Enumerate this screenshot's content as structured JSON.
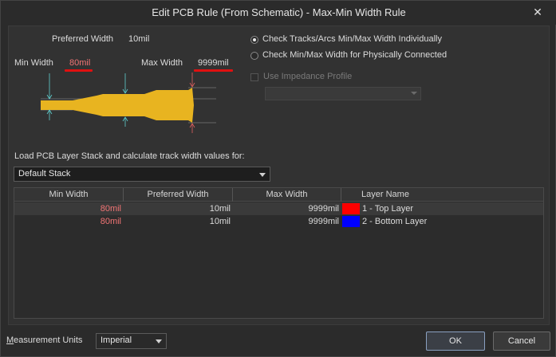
{
  "window": {
    "title": "Edit PCB Rule (From Schematic) - Max-Min Width Rule",
    "close_glyph": "✕"
  },
  "diagram": {
    "preferred_label": "Preferred Width",
    "preferred_value": "10mil",
    "min_label": "Min Width",
    "min_value": "80mil",
    "max_label": "Max Width",
    "max_value": "9999mil",
    "track_color": "#e8b420"
  },
  "options": {
    "radio_individual": "Check Tracks/Arcs Min/Max Width Individually",
    "radio_connected": "Check Min/Max Width for Physically Connected",
    "selected": "individual",
    "impedance_label": "Use Impedance Profile",
    "impedance_checked": false
  },
  "stack": {
    "label": "Load PCB Layer Stack and calculate track width values for:",
    "selected": "Default Stack"
  },
  "table": {
    "headers": [
      "Min Width",
      "Preferred Width",
      "Max Width",
      "Layer Name"
    ],
    "rows": [
      {
        "min": "80mil",
        "preferred": "10mil",
        "max": "9999mil",
        "layer": "1 - Top Layer",
        "color": "#ff0000"
      },
      {
        "min": "80mil",
        "preferred": "10mil",
        "max": "9999mil",
        "layer": "2 - Bottom Layer",
        "color": "#0000ff"
      }
    ]
  },
  "footer": {
    "units_label_first": "M",
    "units_label_rest": "easurement Units",
    "units_value": "Imperial",
    "ok": "OK",
    "cancel": "Cancel"
  }
}
